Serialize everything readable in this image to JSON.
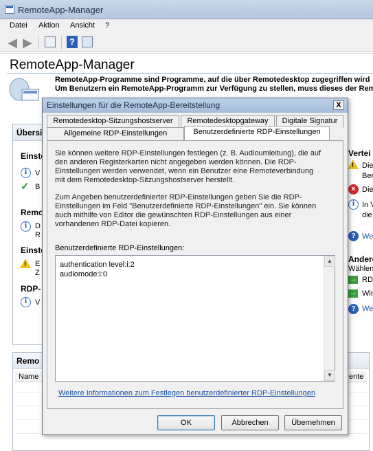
{
  "window": {
    "title": "RemoteApp-Manager"
  },
  "menu": {
    "items": [
      "Datei",
      "Aktion",
      "Ansicht",
      "?"
    ]
  },
  "main": {
    "heading": "RemoteApp-Manager",
    "description": [
      "RemoteApp-Programme sind Programme, auf die über Remotedesktop zugegriffen wird",
      "Um Benutzern ein RemoteApp-Programm zur Verfügung zu stellen, muss dieses der Remote"
    ],
    "left_panel": {
      "header": "Übersi",
      "sections": [
        {
          "title": "Einste",
          "rows": [
            {
              "icon": "info-icon",
              "text": "V"
            },
            {
              "icon": "check-icon",
              "text": "B"
            }
          ]
        },
        {
          "title": "Remo",
          "rows": [
            {
              "icon": "info-icon",
              "text": "D"
            },
            {
              "icon": "",
              "text": "R"
            }
          ]
        },
        {
          "title": "Einste",
          "rows": [
            {
              "icon": "warning-icon",
              "text": "E"
            },
            {
              "icon": "",
              "text": "Z"
            }
          ]
        },
        {
          "title": "RDP-",
          "rows": [
            {
              "icon": "info-icon",
              "text": "V"
            }
          ]
        }
      ]
    },
    "right_panel": {
      "title_1": "Vertei",
      "rows_1": [
        {
          "icon": "warning-icon",
          "text": "Die"
        },
        {
          "icon": "",
          "text": "Ber"
        },
        {
          "icon": "error-icon",
          "text": "Die"
        },
        {
          "icon": "info-icon",
          "text": "In V"
        },
        {
          "icon": "",
          "text": "die"
        }
      ],
      "link_1": "We",
      "title_2": "Andere",
      "subtitle_2": "Wählen",
      "rows_2": [
        {
          "icon": "green-arrow-icon",
          "text": "RD"
        },
        {
          "icon": "green-arrow-icon",
          "text": "Win"
        }
      ],
      "link_2": "We"
    },
    "bottom_panel": {
      "title": "Remo",
      "col_name": "Name",
      "col_right": "ente"
    }
  },
  "dialog": {
    "title": "Einstellungen für die RemoteApp-Bereitstellung",
    "close_label": "X",
    "tabs_row1": [
      "Remotedesktop-Sitzungshostserver",
      "Remotedesktopgateway",
      "Digitale Signatur"
    ],
    "tabs_row2": [
      "Allgemeine RDP-Einstellungen",
      "Benutzerdefinierte RDP-Einstellungen"
    ],
    "active_tab": "Benutzerdefinierte RDP-Einstellungen",
    "paragraph_1": [
      "Sie können weitere RDP-Einstellungen festlegen (z. B. Audioumleitung), die auf",
      "den anderen Registerkarten nicht angegeben werden können. Die RDP-",
      "Einstellungen werden verwendet, wenn ein Benutzer eine Remoteverbindung",
      "mit dem Remotedesktop-Sitzungshostserver herstellt."
    ],
    "paragraph_2": [
      "Zum Angeben benutzerdefinierter RDP-Einstellungen geben Sie die RDP-",
      "Einstellungen im Feld \"Benutzerdefinierte RDP-Einstellungen\" ein. Sie können",
      "auch mithilfe von Editor die gewünschten RDP-Einstellungen aus einer",
      "vorhandenen RDP-Datei kopieren."
    ],
    "field_label": "Benutzerdefinierte RDP-Einstellungen:",
    "field_value": "authentication level:i:2\naudiomode:i:0",
    "link": "Weitere Informationen zum Festlegen benutzerdefinierter RDP-Einstellungen",
    "buttons": {
      "ok": "OK",
      "cancel": "Abbrechen",
      "apply": "Übernehmen"
    }
  }
}
